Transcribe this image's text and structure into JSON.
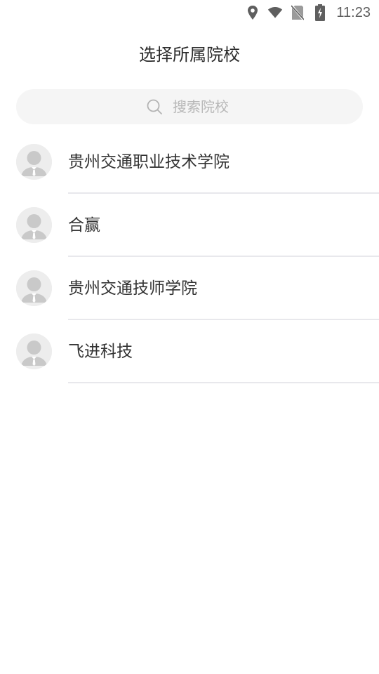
{
  "status_bar": {
    "time": "11:23",
    "icons": [
      "location-icon",
      "wifi-icon",
      "no-sim-icon",
      "battery-charging-icon"
    ]
  },
  "header": {
    "title": "选择所属院校"
  },
  "search": {
    "placeholder": "搜索院校",
    "value": ""
  },
  "schools": [
    {
      "name": "贵州交通职业技术学院"
    },
    {
      "name": "合赢"
    },
    {
      "name": "贵州交通技师学院"
    },
    {
      "name": "飞进科技"
    }
  ],
  "colors": {
    "background": "#ffffff",
    "search_background": "#f5f5f5",
    "placeholder": "#b8b8b8",
    "divider": "#e8e8ec",
    "avatar_background": "#ededed"
  }
}
